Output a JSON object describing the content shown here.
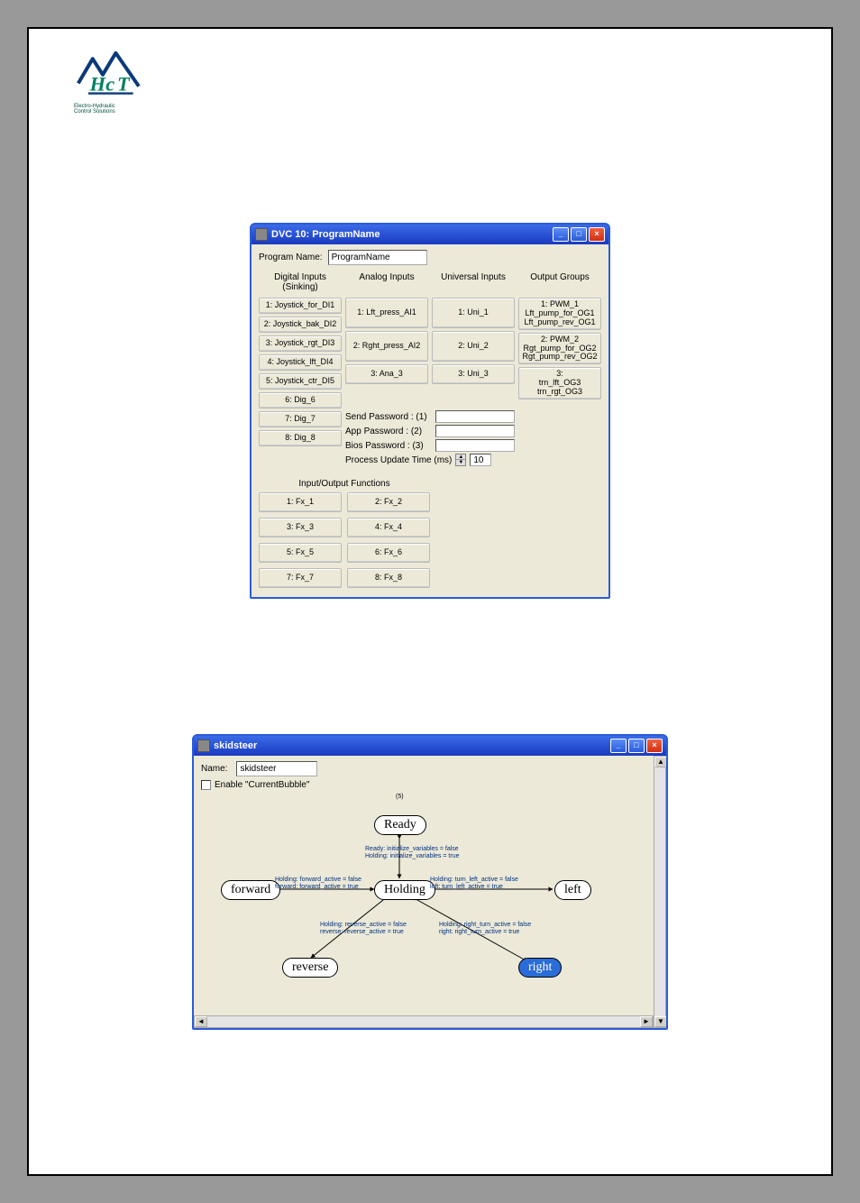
{
  "logo": {
    "line1": "Electro-Hydraulic",
    "line2": "Control Solutions"
  },
  "dvc": {
    "title": "DVC 10: ProgramName",
    "pn_label": "Program Name:",
    "pn_value": "ProgramName",
    "headers": {
      "di": "Digital Inputs (Sinking)",
      "ai": "Analog Inputs",
      "ui": "Universal Inputs",
      "og": "Output Groups"
    },
    "di": [
      "1: Joystick_for_DI1",
      "2: Joystick_bak_DI2",
      "3: Joystick_rgt_DI3",
      "4: Joystick_lft_DI4",
      "5: Joystick_ctr_DI5",
      "6: Dig_6",
      "7: Dig_7",
      "8: Dig_8"
    ],
    "ai": [
      "1: Lft_press_AI1",
      "2: Rght_press_AI2",
      "3: Ana_3"
    ],
    "ui": [
      "1: Uni_1",
      "2: Uni_2",
      "3: Uni_3"
    ],
    "og": [
      "1: PWM_1\nLft_pump_for_OG1\nLft_pump_rev_OG1",
      "2: PWM_2\nRgt_pump_for_OG2\nRgt_pump_rev_OG2",
      "3:\ntrn_lft_OG3\ntrn_rgt_OG3"
    ],
    "pw": {
      "send": "Send Password : (1)",
      "app": "App Password : (2)",
      "bios": "Bios Password : (3)",
      "process": "Process Update Time (ms)",
      "process_val": "10",
      "send_val": "",
      "app_val": "",
      "bios_val": ""
    },
    "iof_head": "Input/Output Functions",
    "iof": [
      "1: Fx_1",
      "2: Fx_2",
      "3: Fx_3",
      "4: Fx_4",
      "5: Fx_5",
      "6: Fx_6",
      "7: Fx_7",
      "8: Fx_8"
    ]
  },
  "ss": {
    "title": "skidsteer",
    "name_label": "Name:",
    "name_value": "skidsteer",
    "enable_label": "Enable \"CurrentBubble\"",
    "marker": "(5)",
    "bubbles": {
      "ready": "Ready",
      "holding": "Holding",
      "forward": "forward",
      "reverse": "reverse",
      "left": "left",
      "right": "right"
    },
    "transitions": {
      "ready": "Ready: initialize_variables = false\nHolding: initialize_variables = true",
      "forward": "Holding: forward_active = false\nforward: forward_active = true",
      "left": "Holding: turn_left_active = false\nleft: turn_left_active = true",
      "reverse": "Holding: reverse_active = false\nreverse: reverse_active = true",
      "right": "Holding: right_turn_active = false\nright: right_turn_active = true"
    }
  },
  "winbtns": {
    "min": "_",
    "max": "□",
    "close": "×"
  }
}
